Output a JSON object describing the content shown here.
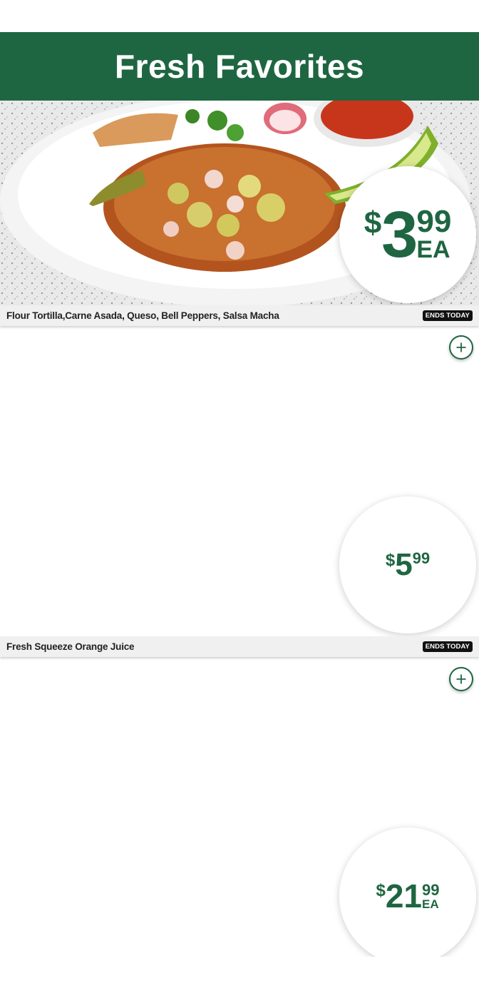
{
  "header": {
    "title": "Fresh Favorites"
  },
  "colors": {
    "brand_green": "#1e6641",
    "name_bar_bg": "#f0f0f0",
    "badge_bg": "#111111"
  },
  "products": [
    {
      "image": "tostada-plate",
      "name": "Flour Tortilla,Carne Asada, Queso, Bell Peppers, Salsa Macha",
      "badge": "ENDS TODAY",
      "price": {
        "currency": "$",
        "dollars": "3",
        "cents": "99",
        "unit": "EA"
      }
    },
    {
      "image": "",
      "name": "Fresh Squeeze Orange Juice",
      "badge": "ENDS TODAY",
      "price": {
        "currency": "$",
        "dollars": "5",
        "cents": "99",
        "unit": ""
      }
    },
    {
      "image": "",
      "name": "",
      "badge": "",
      "price": {
        "currency": "$",
        "dollars": "21",
        "cents": "99",
        "unit": "EA"
      }
    }
  ],
  "add_button": {
    "icon": "plus-icon"
  }
}
